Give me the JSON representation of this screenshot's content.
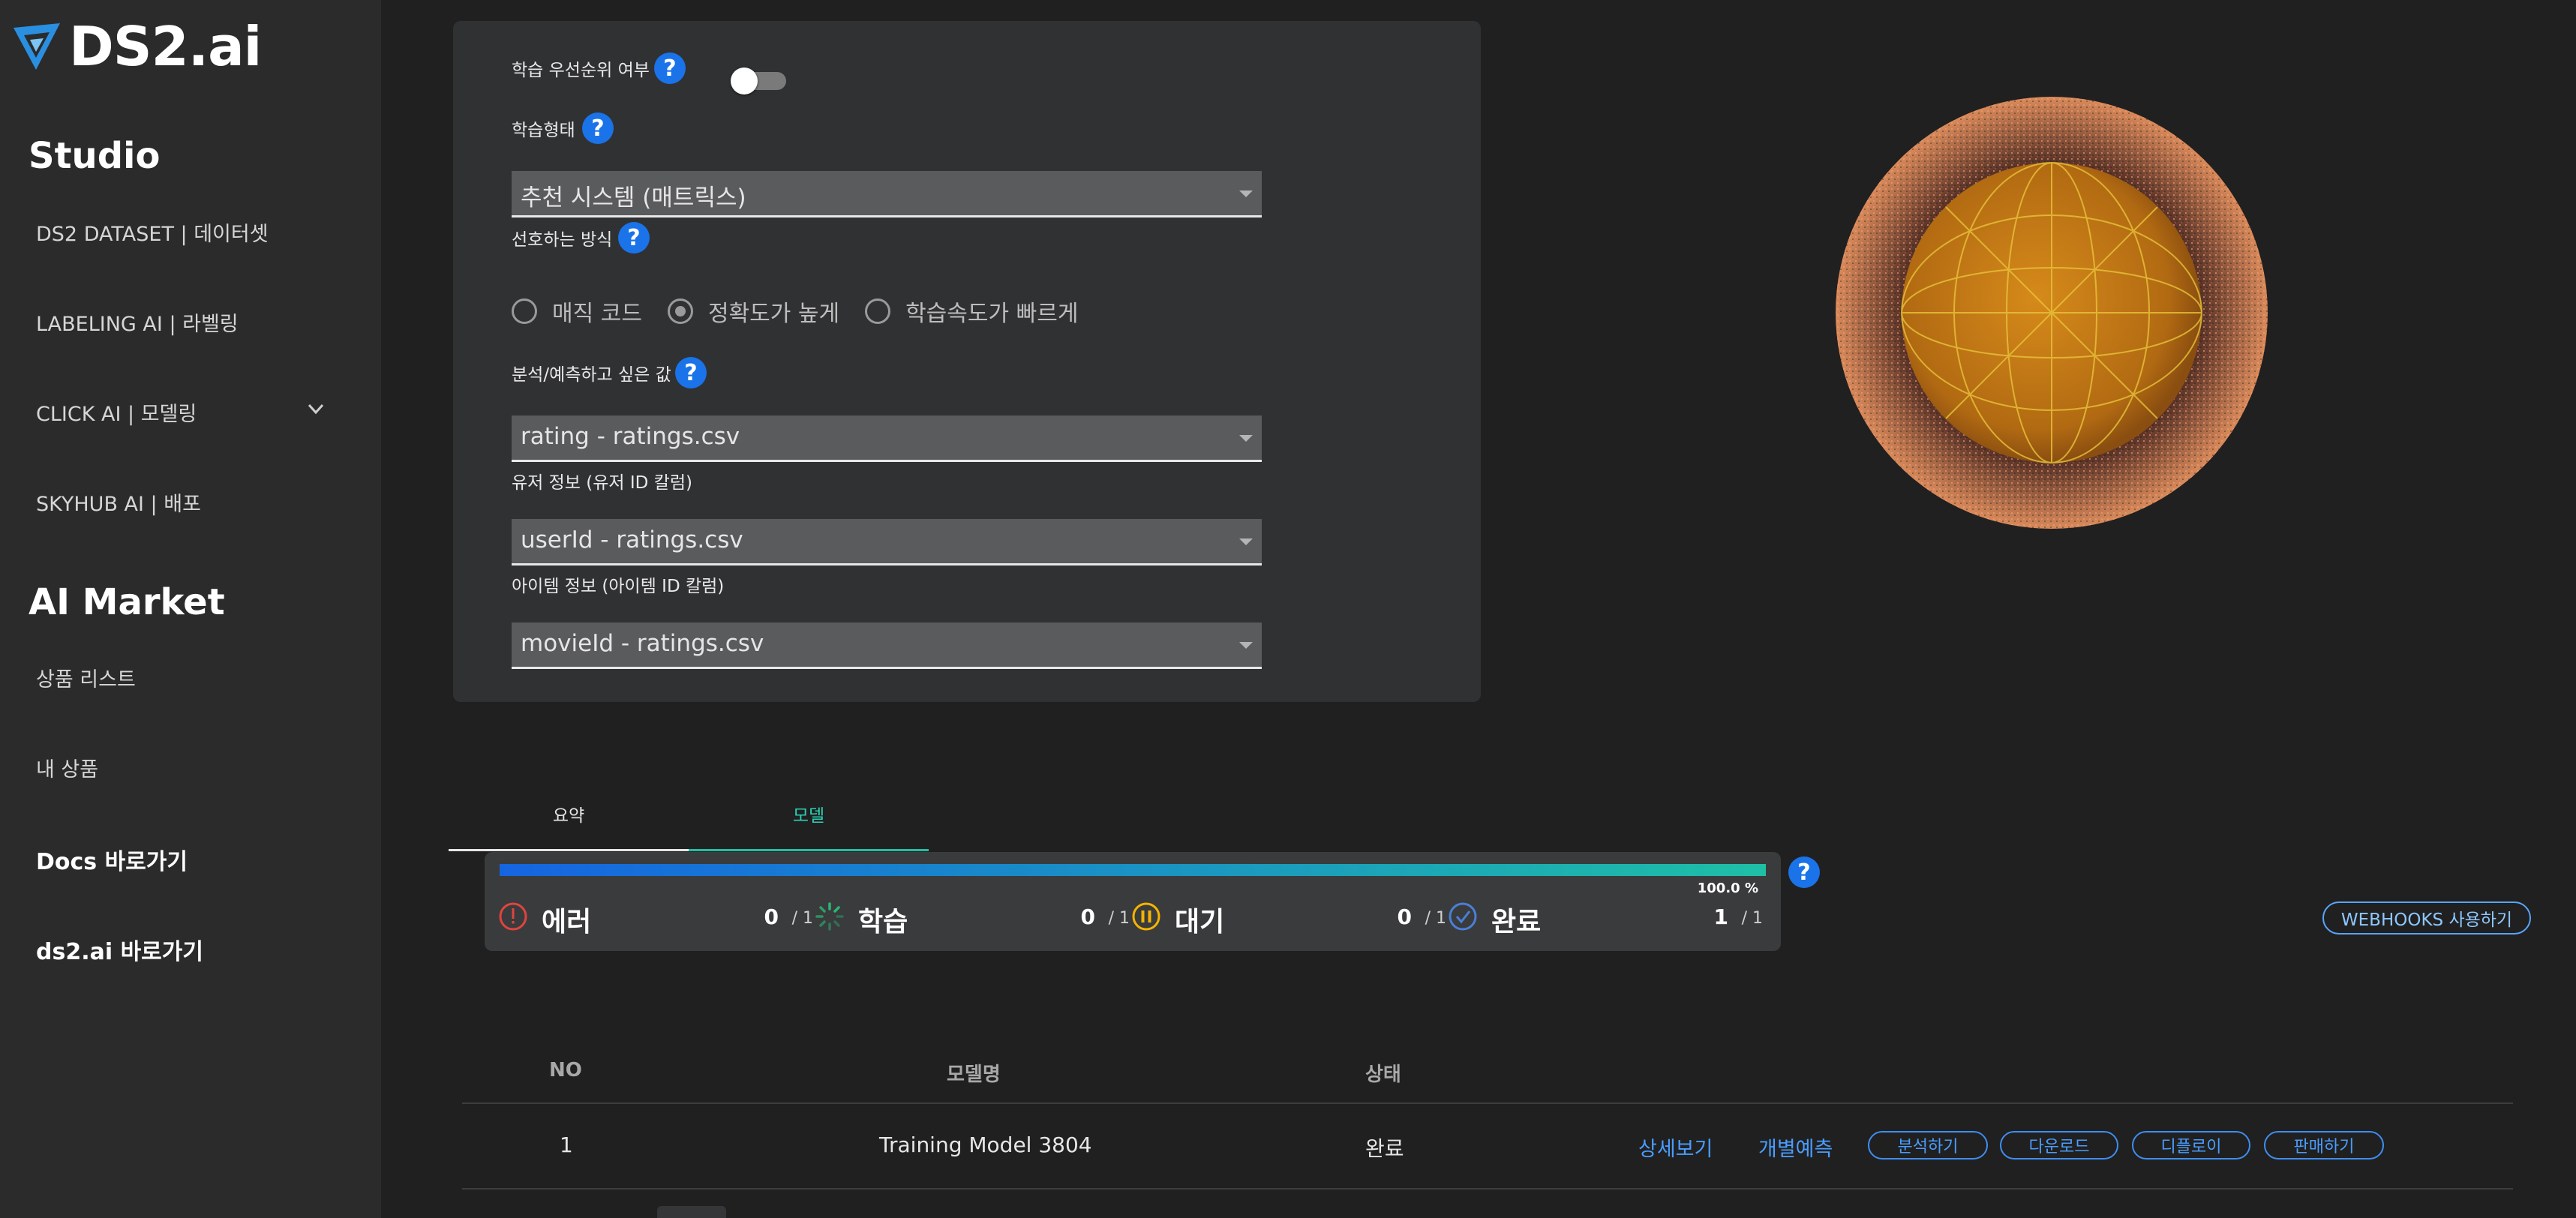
{
  "brand": {
    "logo_text": "DS2.ai"
  },
  "sidebar": {
    "studio_title": "Studio",
    "studio_items": [
      {
        "label": "DS2 DATASET | 데이터셋"
      },
      {
        "label": "LABELING AI | 라벨링"
      },
      {
        "label": "CLICK AI | 모델링"
      },
      {
        "label": "SKYHUB AI | 배포"
      }
    ],
    "market_title": "AI Market",
    "market_items": [
      {
        "label": "상품 리스트"
      },
      {
        "label": "내 상품"
      }
    ],
    "links": [
      {
        "label": "Docs 바로가기"
      },
      {
        "label": "ds2.ai 바로가기"
      }
    ]
  },
  "settings": {
    "priority_label": "학습 우선순위 여부",
    "priority_on": false,
    "train_type_label": "학습형태",
    "train_type_value": "추천 시스템 (매트릭스)",
    "method_label": "선호하는 방식",
    "method_options": [
      "매직 코드",
      "정확도가 높게",
      "학습속도가 빠르게"
    ],
    "method_selected": "정확도가 높게",
    "target_label": "분석/예측하고 싶은 값",
    "target_value": "rating - ratings.csv",
    "user_label": "유저 정보 (유저 ID 칼럼)",
    "user_value": "userId - ratings.csv",
    "item_label": "아이템 정보 (아이템 ID 칼럼)",
    "item_value": "movieId - ratings.csv",
    "help_glyph": "?"
  },
  "tabs": [
    {
      "label": "요약"
    },
    {
      "label": "모델"
    }
  ],
  "status": {
    "progress": 100.0,
    "progress_text": "100.0 %",
    "items": [
      {
        "name": "에러",
        "count": "0",
        "total": " / 1",
        "icon": "error-icon",
        "color": "#e0443e"
      },
      {
        "name": "학습",
        "count": "0",
        "total": " / 1",
        "icon": "spinner-icon",
        "color": "#2bb673"
      },
      {
        "name": "대기",
        "count": "0",
        "total": " / 1",
        "icon": "pause-icon",
        "color": "#f5b400"
      },
      {
        "name": "완료",
        "count": "1",
        "total": " / 1",
        "icon": "check-circle-icon",
        "color": "#4a7fd6"
      }
    ],
    "webhooks_label": "WEBHOOKS 사용하기"
  },
  "table": {
    "headers": {
      "no": "NO",
      "name": "모델명",
      "state": "상태"
    },
    "rows": [
      {
        "no": "1",
        "name": "Training Model 3804",
        "state": "완료",
        "links": [
          "상세보기",
          "개별예측"
        ],
        "buttons": [
          "분석하기",
          "다운로드",
          "디플로이",
          "판매하기"
        ]
      }
    ]
  }
}
